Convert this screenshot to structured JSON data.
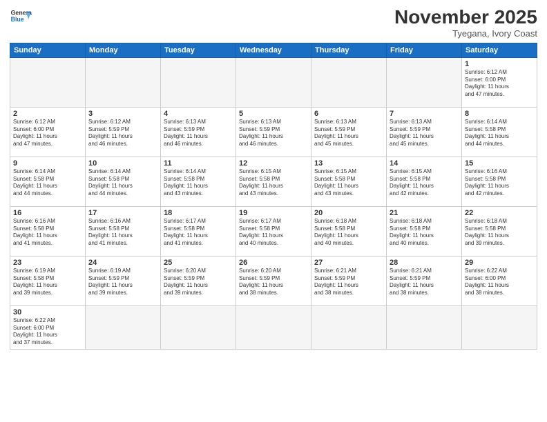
{
  "header": {
    "logo_general": "General",
    "logo_blue": "Blue",
    "month_title": "November 2025",
    "subtitle": "Tyegana, Ivory Coast"
  },
  "days_of_week": [
    "Sunday",
    "Monday",
    "Tuesday",
    "Wednesday",
    "Thursday",
    "Friday",
    "Saturday"
  ],
  "weeks": [
    [
      {
        "day": "",
        "info": ""
      },
      {
        "day": "",
        "info": ""
      },
      {
        "day": "",
        "info": ""
      },
      {
        "day": "",
        "info": ""
      },
      {
        "day": "",
        "info": ""
      },
      {
        "day": "",
        "info": ""
      },
      {
        "day": "1",
        "info": "Sunrise: 6:12 AM\nSunset: 6:00 PM\nDaylight: 11 hours\nand 47 minutes."
      }
    ],
    [
      {
        "day": "2",
        "info": "Sunrise: 6:12 AM\nSunset: 6:00 PM\nDaylight: 11 hours\nand 47 minutes."
      },
      {
        "day": "3",
        "info": "Sunrise: 6:12 AM\nSunset: 5:59 PM\nDaylight: 11 hours\nand 46 minutes."
      },
      {
        "day": "4",
        "info": "Sunrise: 6:13 AM\nSunset: 5:59 PM\nDaylight: 11 hours\nand 46 minutes."
      },
      {
        "day": "5",
        "info": "Sunrise: 6:13 AM\nSunset: 5:59 PM\nDaylight: 11 hours\nand 46 minutes."
      },
      {
        "day": "6",
        "info": "Sunrise: 6:13 AM\nSunset: 5:59 PM\nDaylight: 11 hours\nand 45 minutes."
      },
      {
        "day": "7",
        "info": "Sunrise: 6:13 AM\nSunset: 5:59 PM\nDaylight: 11 hours\nand 45 minutes."
      },
      {
        "day": "8",
        "info": "Sunrise: 6:14 AM\nSunset: 5:58 PM\nDaylight: 11 hours\nand 44 minutes."
      }
    ],
    [
      {
        "day": "9",
        "info": "Sunrise: 6:14 AM\nSunset: 5:58 PM\nDaylight: 11 hours\nand 44 minutes."
      },
      {
        "day": "10",
        "info": "Sunrise: 6:14 AM\nSunset: 5:58 PM\nDaylight: 11 hours\nand 44 minutes."
      },
      {
        "day": "11",
        "info": "Sunrise: 6:14 AM\nSunset: 5:58 PM\nDaylight: 11 hours\nand 43 minutes."
      },
      {
        "day": "12",
        "info": "Sunrise: 6:15 AM\nSunset: 5:58 PM\nDaylight: 11 hours\nand 43 minutes."
      },
      {
        "day": "13",
        "info": "Sunrise: 6:15 AM\nSunset: 5:58 PM\nDaylight: 11 hours\nand 43 minutes."
      },
      {
        "day": "14",
        "info": "Sunrise: 6:15 AM\nSunset: 5:58 PM\nDaylight: 11 hours\nand 42 minutes."
      },
      {
        "day": "15",
        "info": "Sunrise: 6:16 AM\nSunset: 5:58 PM\nDaylight: 11 hours\nand 42 minutes."
      }
    ],
    [
      {
        "day": "16",
        "info": "Sunrise: 6:16 AM\nSunset: 5:58 PM\nDaylight: 11 hours\nand 41 minutes."
      },
      {
        "day": "17",
        "info": "Sunrise: 6:16 AM\nSunset: 5:58 PM\nDaylight: 11 hours\nand 41 minutes."
      },
      {
        "day": "18",
        "info": "Sunrise: 6:17 AM\nSunset: 5:58 PM\nDaylight: 11 hours\nand 41 minutes."
      },
      {
        "day": "19",
        "info": "Sunrise: 6:17 AM\nSunset: 5:58 PM\nDaylight: 11 hours\nand 40 minutes."
      },
      {
        "day": "20",
        "info": "Sunrise: 6:18 AM\nSunset: 5:58 PM\nDaylight: 11 hours\nand 40 minutes."
      },
      {
        "day": "21",
        "info": "Sunrise: 6:18 AM\nSunset: 5:58 PM\nDaylight: 11 hours\nand 40 minutes."
      },
      {
        "day": "22",
        "info": "Sunrise: 6:18 AM\nSunset: 5:58 PM\nDaylight: 11 hours\nand 39 minutes."
      }
    ],
    [
      {
        "day": "23",
        "info": "Sunrise: 6:19 AM\nSunset: 5:58 PM\nDaylight: 11 hours\nand 39 minutes."
      },
      {
        "day": "24",
        "info": "Sunrise: 6:19 AM\nSunset: 5:59 PM\nDaylight: 11 hours\nand 39 minutes."
      },
      {
        "day": "25",
        "info": "Sunrise: 6:20 AM\nSunset: 5:59 PM\nDaylight: 11 hours\nand 39 minutes."
      },
      {
        "day": "26",
        "info": "Sunrise: 6:20 AM\nSunset: 5:59 PM\nDaylight: 11 hours\nand 38 minutes."
      },
      {
        "day": "27",
        "info": "Sunrise: 6:21 AM\nSunset: 5:59 PM\nDaylight: 11 hours\nand 38 minutes."
      },
      {
        "day": "28",
        "info": "Sunrise: 6:21 AM\nSunset: 5:59 PM\nDaylight: 11 hours\nand 38 minutes."
      },
      {
        "day": "29",
        "info": "Sunrise: 6:22 AM\nSunset: 6:00 PM\nDaylight: 11 hours\nand 38 minutes."
      }
    ],
    [
      {
        "day": "30",
        "info": "Sunrise: 6:22 AM\nSunset: 6:00 PM\nDaylight: 11 hours\nand 37 minutes."
      },
      {
        "day": "",
        "info": ""
      },
      {
        "day": "",
        "info": ""
      },
      {
        "day": "",
        "info": ""
      },
      {
        "day": "",
        "info": ""
      },
      {
        "day": "",
        "info": ""
      },
      {
        "day": "",
        "info": ""
      }
    ]
  ]
}
